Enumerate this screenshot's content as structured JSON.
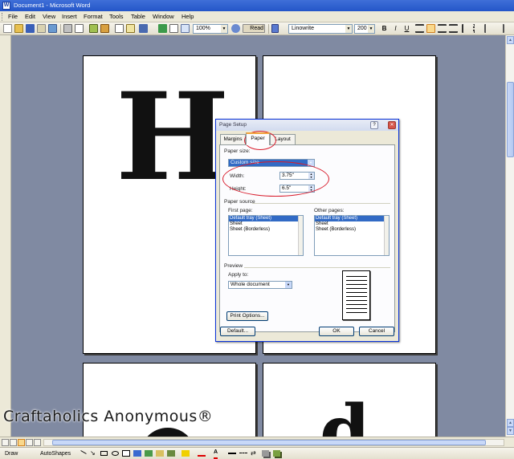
{
  "window": {
    "title": "Document1 - Microsoft Word"
  },
  "menu": [
    "File",
    "Edit",
    "View",
    "Insert",
    "Format",
    "Tools",
    "Table",
    "Window",
    "Help"
  ],
  "toolbar": {
    "zoom": "100%",
    "read_label": "Read",
    "font_name": "Linowrite",
    "font_size": "200"
  },
  "document": {
    "letter_top": "H",
    "letter_bottom_left": "",
    "letter_bottom_right": "d"
  },
  "dialog": {
    "title": "Page Setup",
    "tabs": [
      "Margins",
      "Paper",
      "Layout"
    ],
    "active_tab": "Paper",
    "paper_size_label": "Paper size:",
    "paper_size_value": "Custom size",
    "width_label": "Width:",
    "width_value": "3.75\"",
    "height_label": "Height:",
    "height_value": "6.5\"",
    "paper_source_label": "Paper source",
    "first_page_label": "First page:",
    "other_pages_label": "Other pages:",
    "first_page_options": [
      "Default tray (Sheet)",
      "Sheet",
      "Sheet (Borderless)"
    ],
    "other_pages_options": [
      "Default tray (Sheet)",
      "Sheet",
      "Sheet (Borderless)"
    ],
    "preview_label": "Preview",
    "apply_to_label": "Apply to:",
    "apply_to_value": "Whole document",
    "print_options_label": "Print Options...",
    "default_label": "Default...",
    "ok_label": "OK",
    "cancel_label": "Cancel"
  },
  "drawing_toolbar": {
    "draw_label": "Draw",
    "autoshapes_label": "AutoShapes"
  },
  "watermark": "Craftaholics Anonymous®",
  "colors": {
    "annotation": "#d81b2b",
    "titlebar": "#2456c8",
    "workspace": "#808aa2"
  }
}
